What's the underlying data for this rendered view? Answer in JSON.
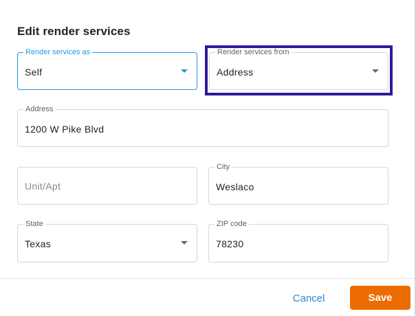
{
  "dialog": {
    "title": "Edit render services"
  },
  "fields": {
    "render_as": {
      "label": "Render services as",
      "value": "Self",
      "icon": "chevron-down-icon"
    },
    "render_from": {
      "label": "Render services from",
      "value": "Address",
      "icon": "chevron-down-icon"
    },
    "address": {
      "label": "Address",
      "value": "1200 W Pike Blvd"
    },
    "unit": {
      "placeholder": "Unit/Apt",
      "value": ""
    },
    "city": {
      "label": "City",
      "value": "Weslaco"
    },
    "state": {
      "label": "State",
      "value": "Texas",
      "icon": "chevron-down-icon"
    },
    "zip": {
      "label": "ZIP code",
      "value": "78230"
    }
  },
  "footer": {
    "cancel_label": "Cancel",
    "save_label": "Save"
  },
  "colors": {
    "accent": "#2196e6",
    "highlight": "#2e1a9c",
    "save_button": "#ed6c02",
    "cancel_text": "#2c87d6"
  }
}
